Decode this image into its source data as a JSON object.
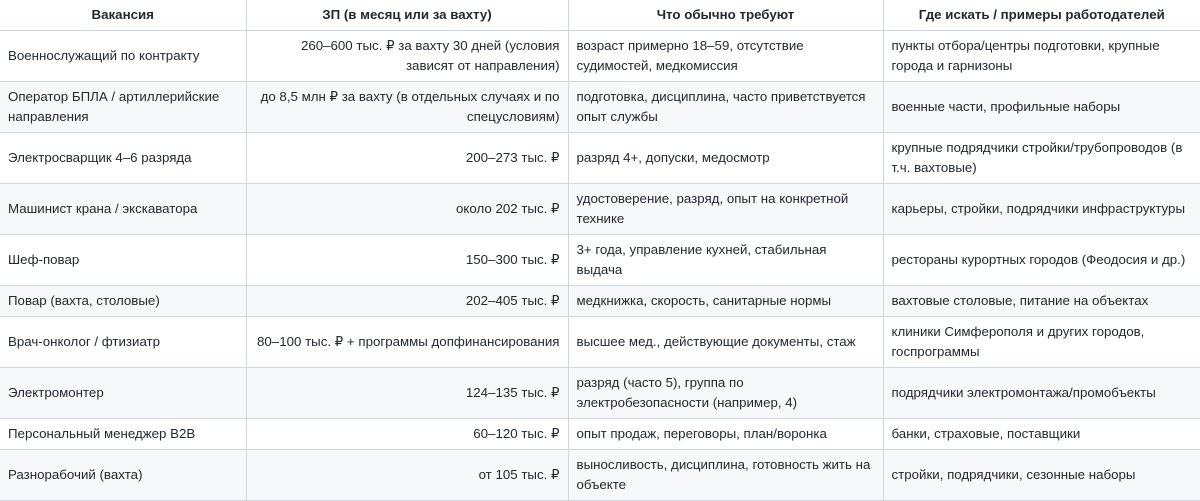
{
  "table": {
    "headers": [
      "Вакансия",
      "ЗП (в месяц или за вахту)",
      "Что обычно требуют",
      "Где искать / примеры работодателей"
    ],
    "rows": [
      {
        "vacancy": "Военнослужащий по контракту",
        "salary": "260–600 тыс. ₽ за вахту 30 дней (условия зависят от направления)",
        "requirements": "возраст примерно 18–59, отсутствие судимостей, медкомиссия",
        "where": "пункты отбора/центры подготовки, крупные города и гарнизоны"
      },
      {
        "vacancy": "Оператор БПЛА / артиллерийские направления",
        "salary": "до 8,5 млн ₽ за вахту (в отдельных случаях и по спецусловиям)",
        "requirements": "подготовка, дисциплина, часто приветствуется опыт службы",
        "where": "военные части, профильные наборы"
      },
      {
        "vacancy": "Электросварщик 4–6 разряда",
        "salary": "200–273 тыс. ₽",
        "requirements": "разряд 4+, допуски, медосмотр",
        "where": "крупные подрядчики стройки/трубопроводов (в т.ч. вахтовые)"
      },
      {
        "vacancy": "Машинист крана / экскаватора",
        "salary": "около 202 тыс. ₽",
        "requirements": "удостоверение, разряд, опыт на конкретной технике",
        "where": "карьеры, стройки, подрядчики инфраструктуры"
      },
      {
        "vacancy": "Шеф-повар",
        "salary": "150–300 тыс. ₽",
        "requirements": "3+ года, управление кухней, стабильная выдача",
        "where": "рестораны курортных городов (Феодосия и др.)"
      },
      {
        "vacancy": "Повар (вахта, столовые)",
        "salary": "202–405 тыс. ₽",
        "requirements": "медкнижка, скорость, санитарные нормы",
        "where": "вахтовые столовые, питание на объектах"
      },
      {
        "vacancy": "Врач-онколог / фтизиатр",
        "salary": "80–100 тыс. ₽ + программы допфинансирования",
        "requirements": "высшее мед., действующие документы, стаж",
        "where": "клиники Симферополя и других городов, госпрограммы"
      },
      {
        "vacancy": "Электромонтер",
        "salary": "124–135 тыс. ₽",
        "requirements": "разряд (часто 5), группа по электробезопасности (например, 4)",
        "where": "подрядчики электромонтажа/промобъекты"
      },
      {
        "vacancy": "Персональный менеджер B2B",
        "salary": "60–120 тыс. ₽",
        "requirements": "опыт продаж, переговоры, план/воронка",
        "where": "банки, страховые, поставщики"
      },
      {
        "vacancy": "Разнорабочий (вахта)",
        "salary": "от 105 тыс. ₽",
        "requirements": "выносливость, дисциплина, готовность жить на объекте",
        "where": "стройки, подрядчики, сезонные наборы"
      }
    ]
  }
}
